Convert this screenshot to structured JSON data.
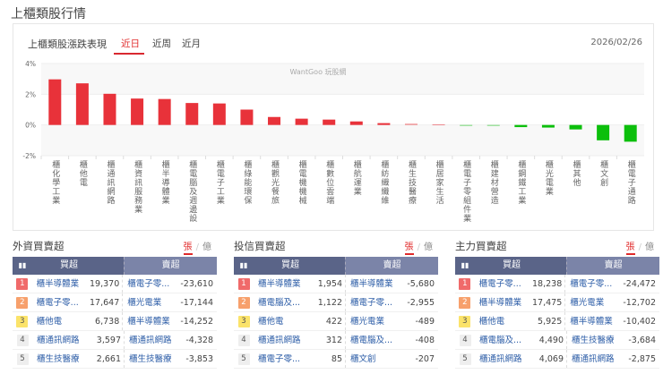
{
  "page_title": "上櫃類股行情",
  "chart_card": {
    "title": "上櫃類股漲跌表現",
    "tabs": [
      "近日",
      "近周",
      "近月"
    ],
    "active_tab": 0,
    "date": "2026/02/26",
    "watermark": "WantGoo 玩股網"
  },
  "colors": {
    "up": "#e8323a",
    "down": "#0cbf0c",
    "accent": "#d9282f",
    "header": "#5a6488"
  },
  "chart_data": {
    "type": "bar",
    "title": "上櫃類股漲跌表現",
    "categories": [
      "櫃化學工業",
      "櫃他電",
      "櫃通訊網路",
      "櫃資訊服務業",
      "櫃半導體業",
      "櫃電腦及週邊設",
      "櫃電子工業",
      "櫃綠能環保",
      "櫃觀光餐旅",
      "櫃電機機械",
      "櫃數位雲端",
      "櫃航運業",
      "櫃紡織纖維",
      "櫃生技醫療",
      "櫃居家生活",
      "櫃電子零組件業",
      "櫃建材營造",
      "櫃鋼鐵工業",
      "櫃光電業",
      "櫃其他",
      "櫃文創",
      "櫃電子通路"
    ],
    "values": [
      2.97,
      2.71,
      2.03,
      1.72,
      1.69,
      1.43,
      1.4,
      1.0,
      0.52,
      0.41,
      0.35,
      0.23,
      0.12,
      0.08,
      0.04,
      -0.02,
      -0.05,
      -0.14,
      -0.17,
      -0.29,
      -1.0,
      -1.09
    ],
    "ylim": [
      -2,
      4
    ],
    "yticks": [
      "4%",
      "2%",
      "0%",
      "-2%"
    ],
    "ytick_values": [
      4,
      2,
      0,
      -2
    ],
    "ylabel": "",
    "xlabel": ""
  },
  "tables": [
    {
      "title": "外資買賣超",
      "unit_on": "張",
      "unit_off": "億",
      "buy_header": "買超",
      "sell_header": "賣超",
      "rows": [
        {
          "rank": "1",
          "buy": "櫃半導體業",
          "buy_val": "19,370",
          "sell": "櫃電子零...",
          "sell_val": "-23,610"
        },
        {
          "rank": "2",
          "buy": "櫃電子零...",
          "buy_val": "17,647",
          "sell": "櫃光電業",
          "sell_val": "-17,144"
        },
        {
          "rank": "3",
          "buy": "櫃他電",
          "buy_val": "6,738",
          "sell": "櫃半導體業",
          "sell_val": "-14,252"
        },
        {
          "rank": "4",
          "buy": "櫃通訊網路",
          "buy_val": "3,597",
          "sell": "櫃通訊網路",
          "sell_val": "-4,328"
        },
        {
          "rank": "5",
          "buy": "櫃生技醫療",
          "buy_val": "2,661",
          "sell": "櫃生技醫療",
          "sell_val": "-3,853"
        }
      ]
    },
    {
      "title": "投信買賣超",
      "unit_on": "張",
      "unit_off": "億",
      "buy_header": "買超",
      "sell_header": "賣超",
      "rows": [
        {
          "rank": "1",
          "buy": "櫃半導體業",
          "buy_val": "1,954",
          "sell": "櫃半導體業",
          "sell_val": "-5,680"
        },
        {
          "rank": "2",
          "buy": "櫃電腦及...",
          "buy_val": "1,122",
          "sell": "櫃電子零...",
          "sell_val": "-2,955"
        },
        {
          "rank": "3",
          "buy": "櫃他電",
          "buy_val": "422",
          "sell": "櫃光電業",
          "sell_val": "-489"
        },
        {
          "rank": "4",
          "buy": "櫃通訊網路",
          "buy_val": "312",
          "sell": "櫃電腦及...",
          "sell_val": "-408"
        },
        {
          "rank": "5",
          "buy": "櫃電子零...",
          "buy_val": "85",
          "sell": "櫃文創",
          "sell_val": "-207"
        }
      ]
    },
    {
      "title": "主力買賣超",
      "unit_on": "張",
      "unit_off": "億",
      "buy_header": "買超",
      "sell_header": "賣超",
      "rows": [
        {
          "rank": "1",
          "buy": "櫃電子零...",
          "buy_val": "18,238",
          "sell": "櫃電子零...",
          "sell_val": "-24,472"
        },
        {
          "rank": "2",
          "buy": "櫃半導體業",
          "buy_val": "17,475",
          "sell": "櫃光電業",
          "sell_val": "-12,702"
        },
        {
          "rank": "3",
          "buy": "櫃他電",
          "buy_val": "5,925",
          "sell": "櫃半導體業",
          "sell_val": "-10,402"
        },
        {
          "rank": "4",
          "buy": "櫃電腦及...",
          "buy_val": "4,490",
          "sell": "櫃生技醫療",
          "sell_val": "-3,684"
        },
        {
          "rank": "5",
          "buy": "櫃通訊網路",
          "buy_val": "4,069",
          "sell": "櫃通訊網路",
          "sell_val": "-2,875"
        }
      ]
    }
  ]
}
